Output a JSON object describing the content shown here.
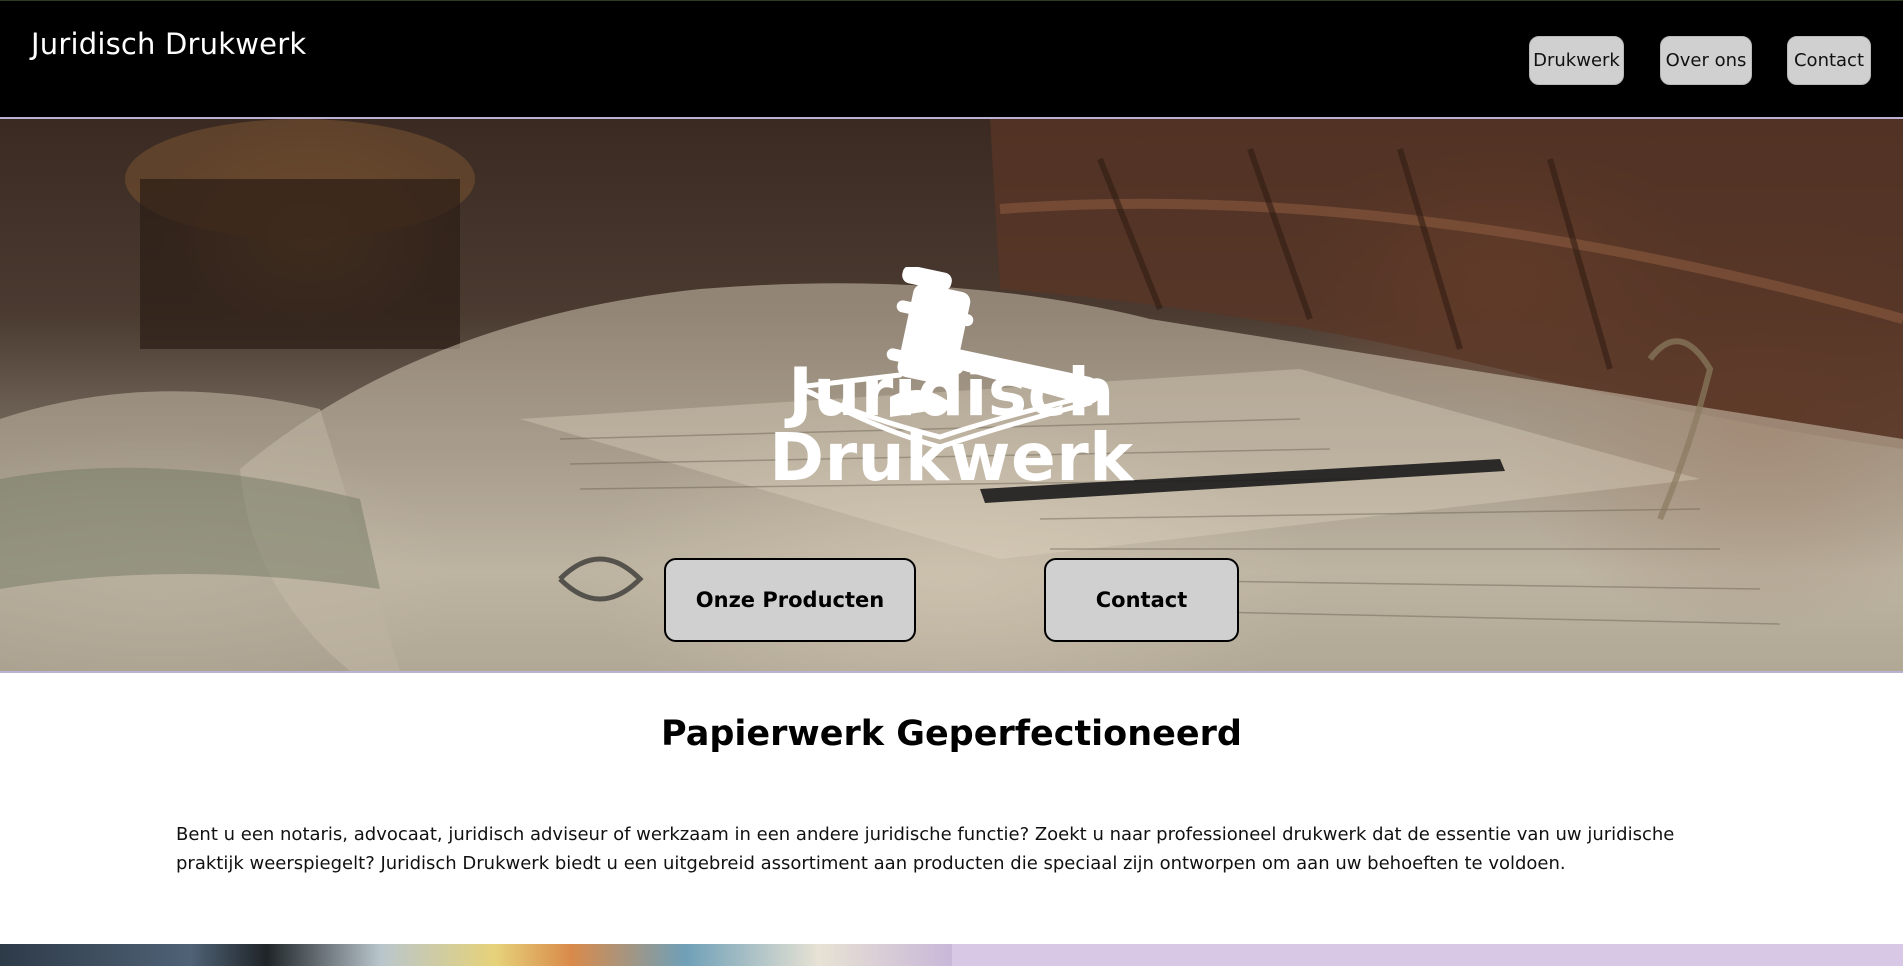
{
  "header": {
    "brand": "Juridisch Drukwerk",
    "nav": [
      {
        "label": "Drukwerk"
      },
      {
        "label": "Over ons"
      },
      {
        "label": "Contact"
      }
    ]
  },
  "hero": {
    "logo_icon": "gavel-icon",
    "logo_line1": "Juridisch",
    "logo_line2": "Drukwerk",
    "buttons": [
      {
        "label": "Onze Producten"
      },
      {
        "label": "Contact"
      }
    ]
  },
  "main": {
    "title": "Papierwerk Geperfectioneerd",
    "intro": "Bent u een notaris, advocaat, juridisch adviseur of werkzaam in een andere juridische functie? Zoekt u naar professioneel drukwerk dat de essentie van uw juridische praktijk weerspiegelt? Juridisch Drukwerk biedt u een uitgebreid assortiment aan producten die speciaal zijn ontworpen om aan uw behoeften te voldoen."
  },
  "colors": {
    "header_bg": "#000000",
    "button_bg": "#d0d0d0",
    "accent_lavender": "#d8c8e6"
  }
}
